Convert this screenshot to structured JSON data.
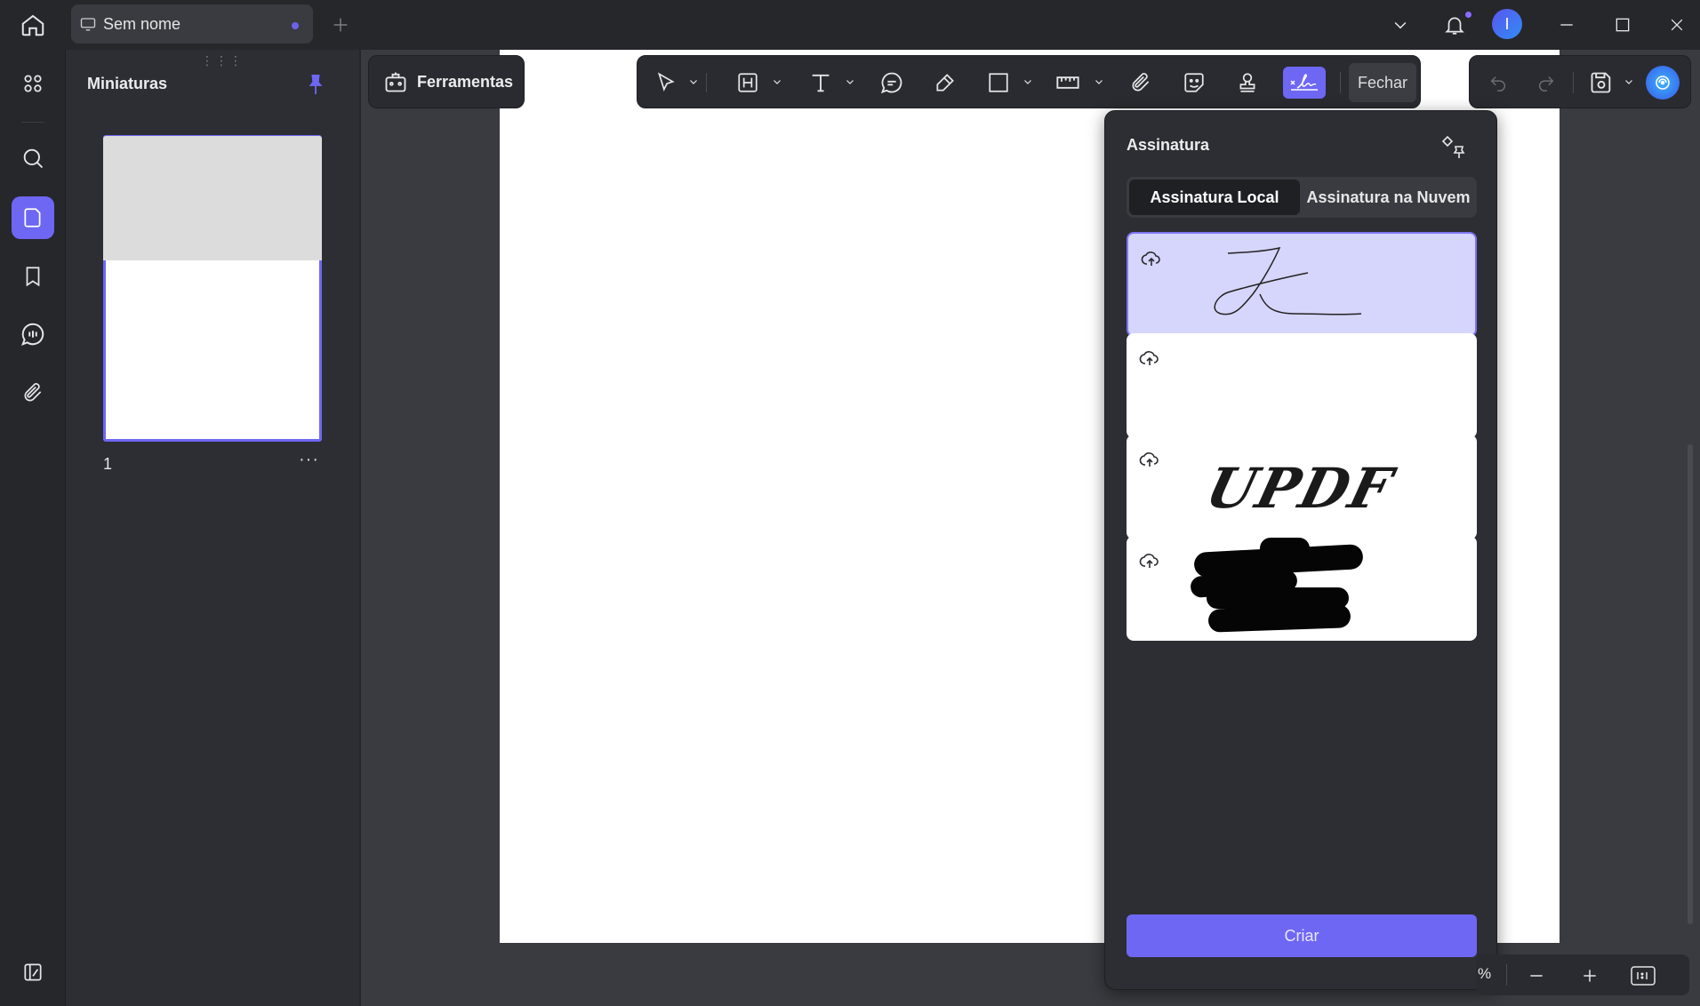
{
  "tab": {
    "title": "Sem nome"
  },
  "avatar": {
    "initial": "I"
  },
  "sidebar": {
    "items": [
      {
        "icon": "apps-grid-icon"
      },
      {
        "icon": "search-icon"
      },
      {
        "icon": "pages-icon",
        "active": true
      },
      {
        "icon": "bookmark-icon"
      },
      {
        "icon": "comment-icon"
      },
      {
        "icon": "attachment-icon"
      }
    ],
    "bottom_icon": "layout-icon"
  },
  "thumbnails": {
    "title": "Miniaturas",
    "pages": [
      {
        "number": "1",
        "more": "···"
      }
    ]
  },
  "toolbar": {
    "tools_label": "Ferramentas",
    "close_label": "Fechar"
  },
  "signature_panel": {
    "title": "Assinatura",
    "tabs": {
      "local": "Assinatura Local",
      "cloud": "Assinatura na Nuvem"
    },
    "signatures": [
      {
        "type": "handwritten-scribble",
        "selected": true
      },
      {
        "type": "empty"
      },
      {
        "type": "text",
        "text": "UPDF"
      },
      {
        "type": "redacted"
      }
    ],
    "create_label": "Criar"
  },
  "zoom": {
    "value": "%"
  },
  "colors": {
    "accent": "#6e67f4",
    "background": "#26272b",
    "panel": "#2d2e33"
  }
}
